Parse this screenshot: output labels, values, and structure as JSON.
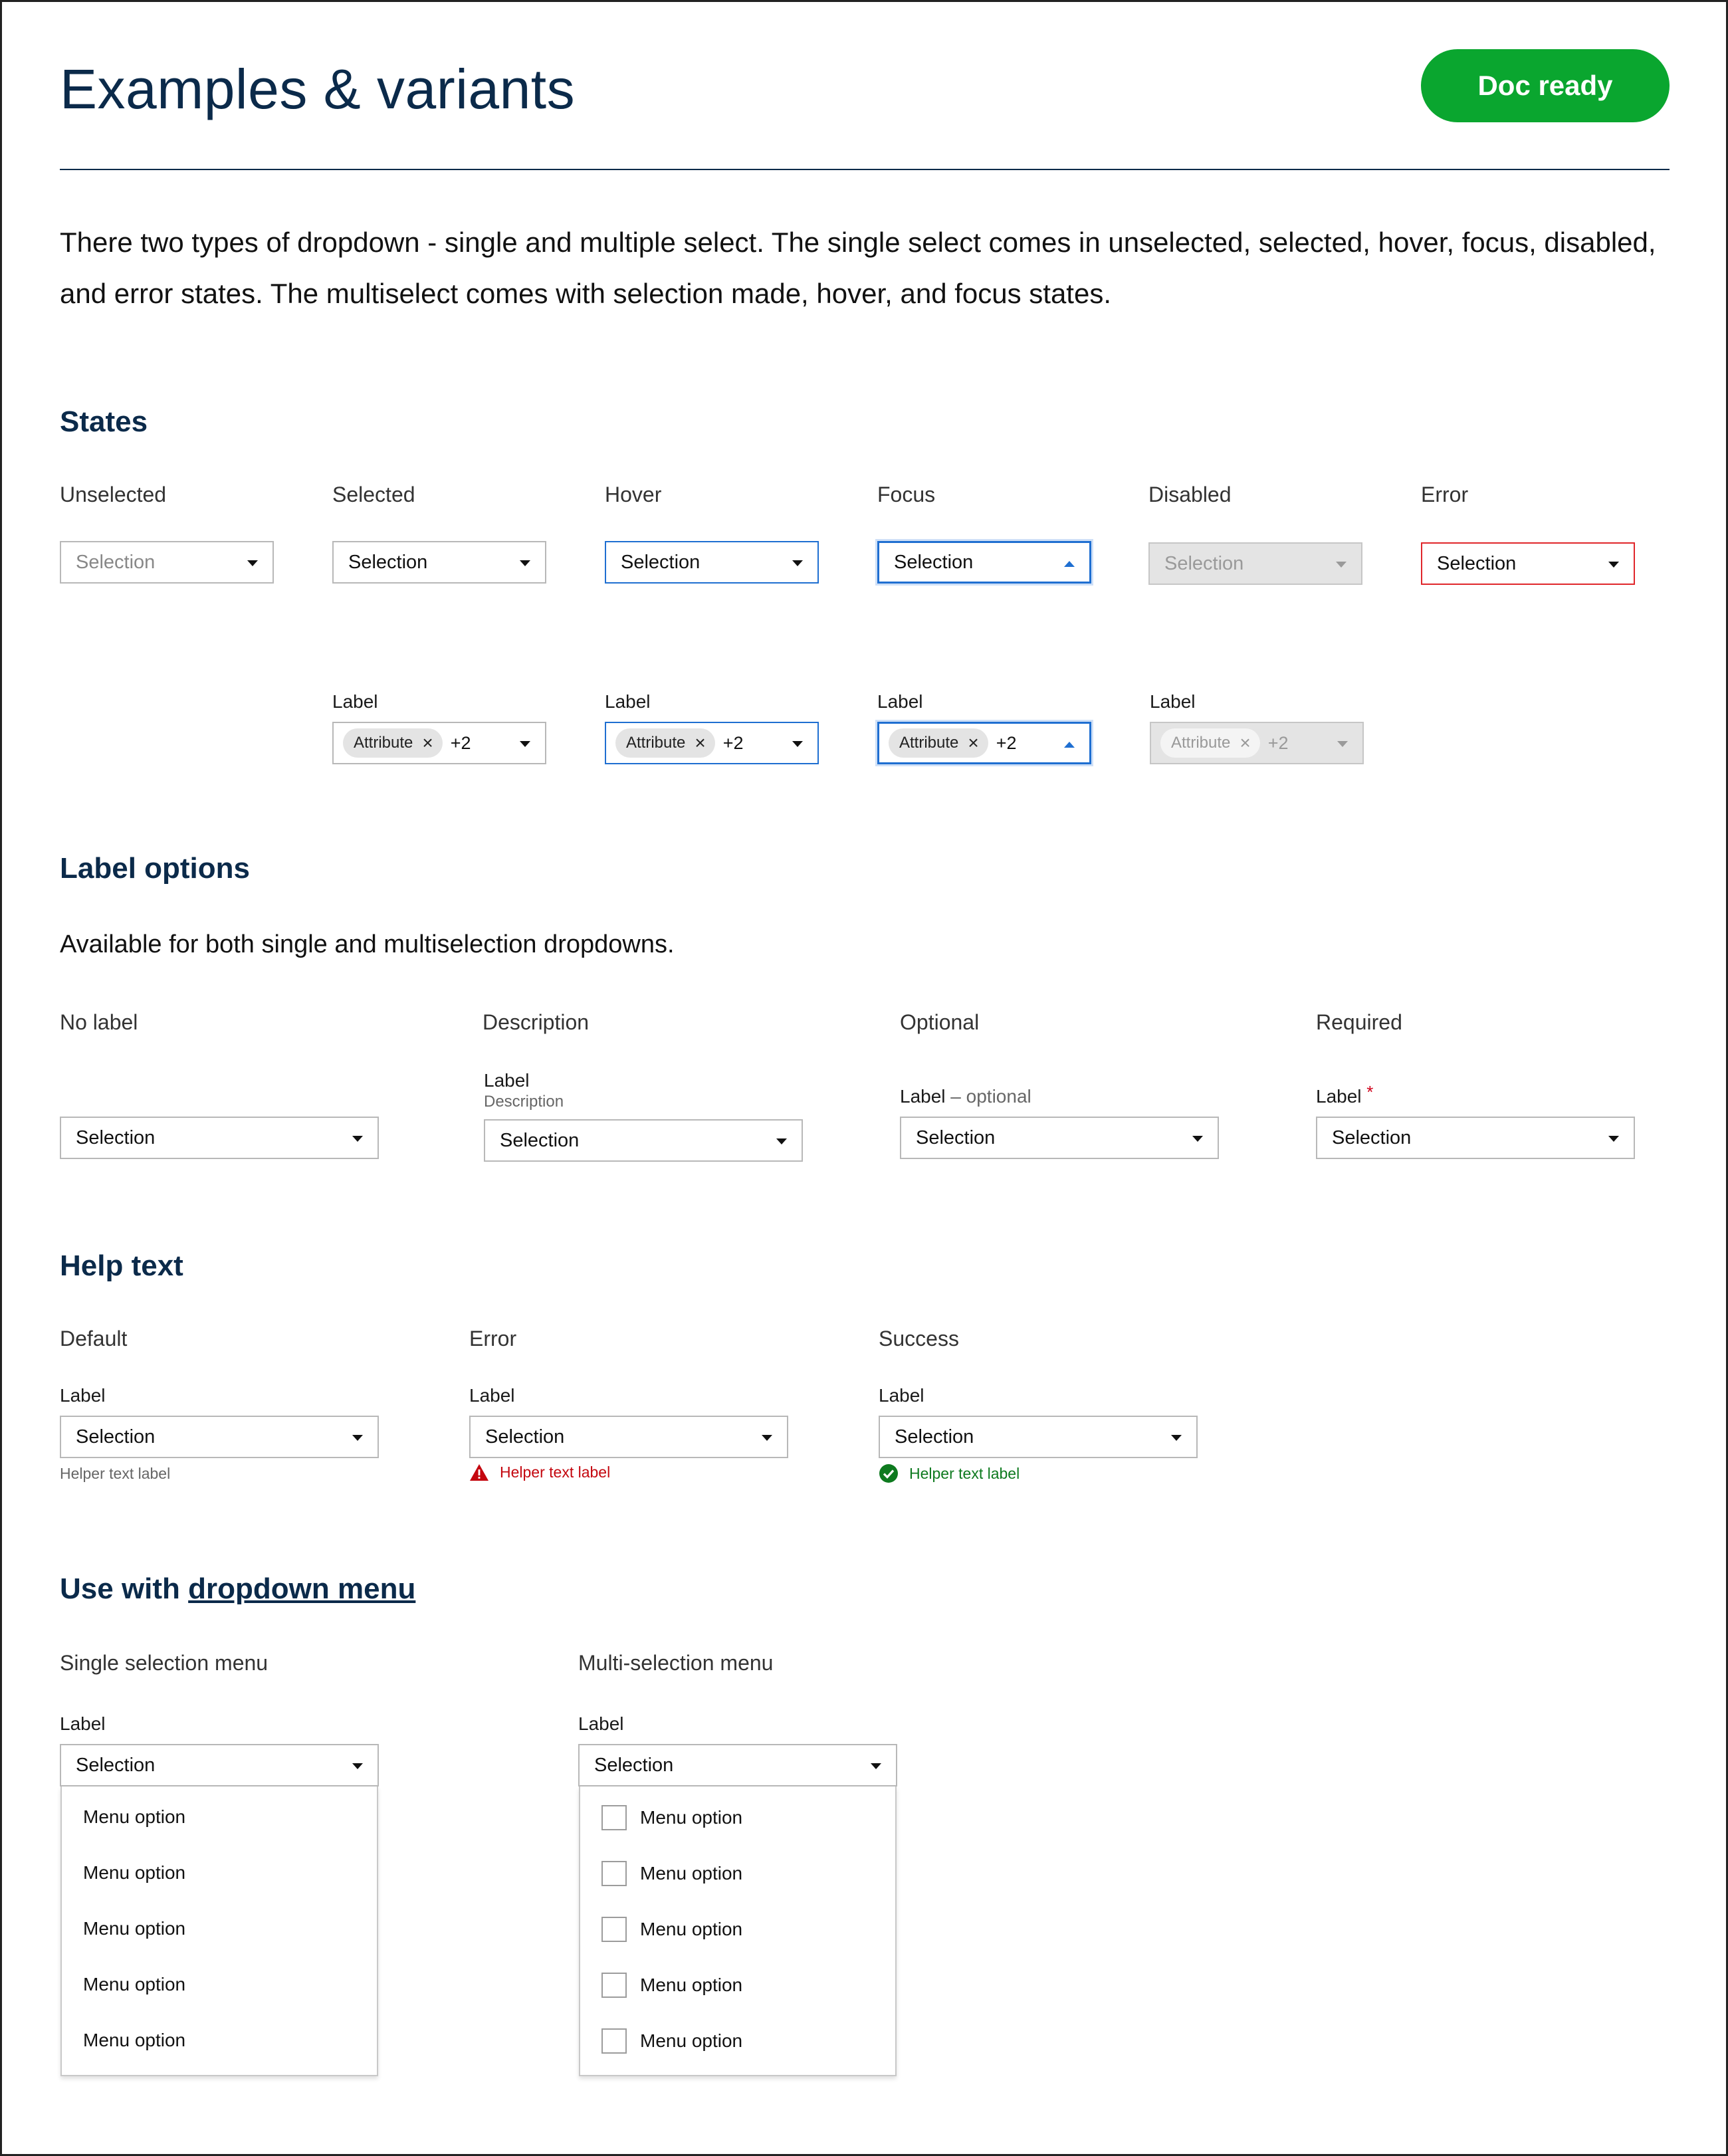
{
  "header": {
    "title": "Examples & variants",
    "badge": "Doc ready",
    "intro": "There two types of dropdown - single and multiple select. The single select comes in unselected, selected, hover, focus, disabled, and error states. The multiselect comes with selection made, hover, and focus states."
  },
  "states": {
    "heading": "States",
    "columns": [
      "Unselected",
      "Selected",
      "Hover",
      "Focus",
      "Disabled",
      "Error"
    ],
    "selection_text": "Selection",
    "multi_label": "Label",
    "chip_text": "Attribute",
    "chip_more": "+2"
  },
  "label_options": {
    "heading": "Label options",
    "subtext": "Available for both single and multiselection dropdowns.",
    "columns": [
      "No label",
      "Description",
      "Optional",
      "Required"
    ],
    "label": "Label",
    "description": "Description",
    "optional_suffix": "– optional",
    "required_mark": "*",
    "selection_text": "Selection"
  },
  "help_text": {
    "heading": "Help text",
    "columns": [
      "Default",
      "Error",
      "Success"
    ],
    "label": "Label",
    "selection_text": "Selection",
    "helper": "Helper text label",
    "colors": {
      "error": "#c4070f",
      "success": "#0e7a1f"
    }
  },
  "menu_usage": {
    "heading_prefix": "Use with",
    "heading_link": "dropdown menu",
    "columns": [
      "Single selection menu",
      "Multi-selection menu"
    ],
    "label": "Label",
    "selection_text": "Selection",
    "options": [
      "Menu option",
      "Menu option",
      "Menu option",
      "Menu option",
      "Menu option"
    ]
  },
  "colors": {
    "title": "#0b2a4a",
    "badge": "#0aa62f",
    "focus_border": "#1f6fd1",
    "error_border": "#e0262b"
  }
}
